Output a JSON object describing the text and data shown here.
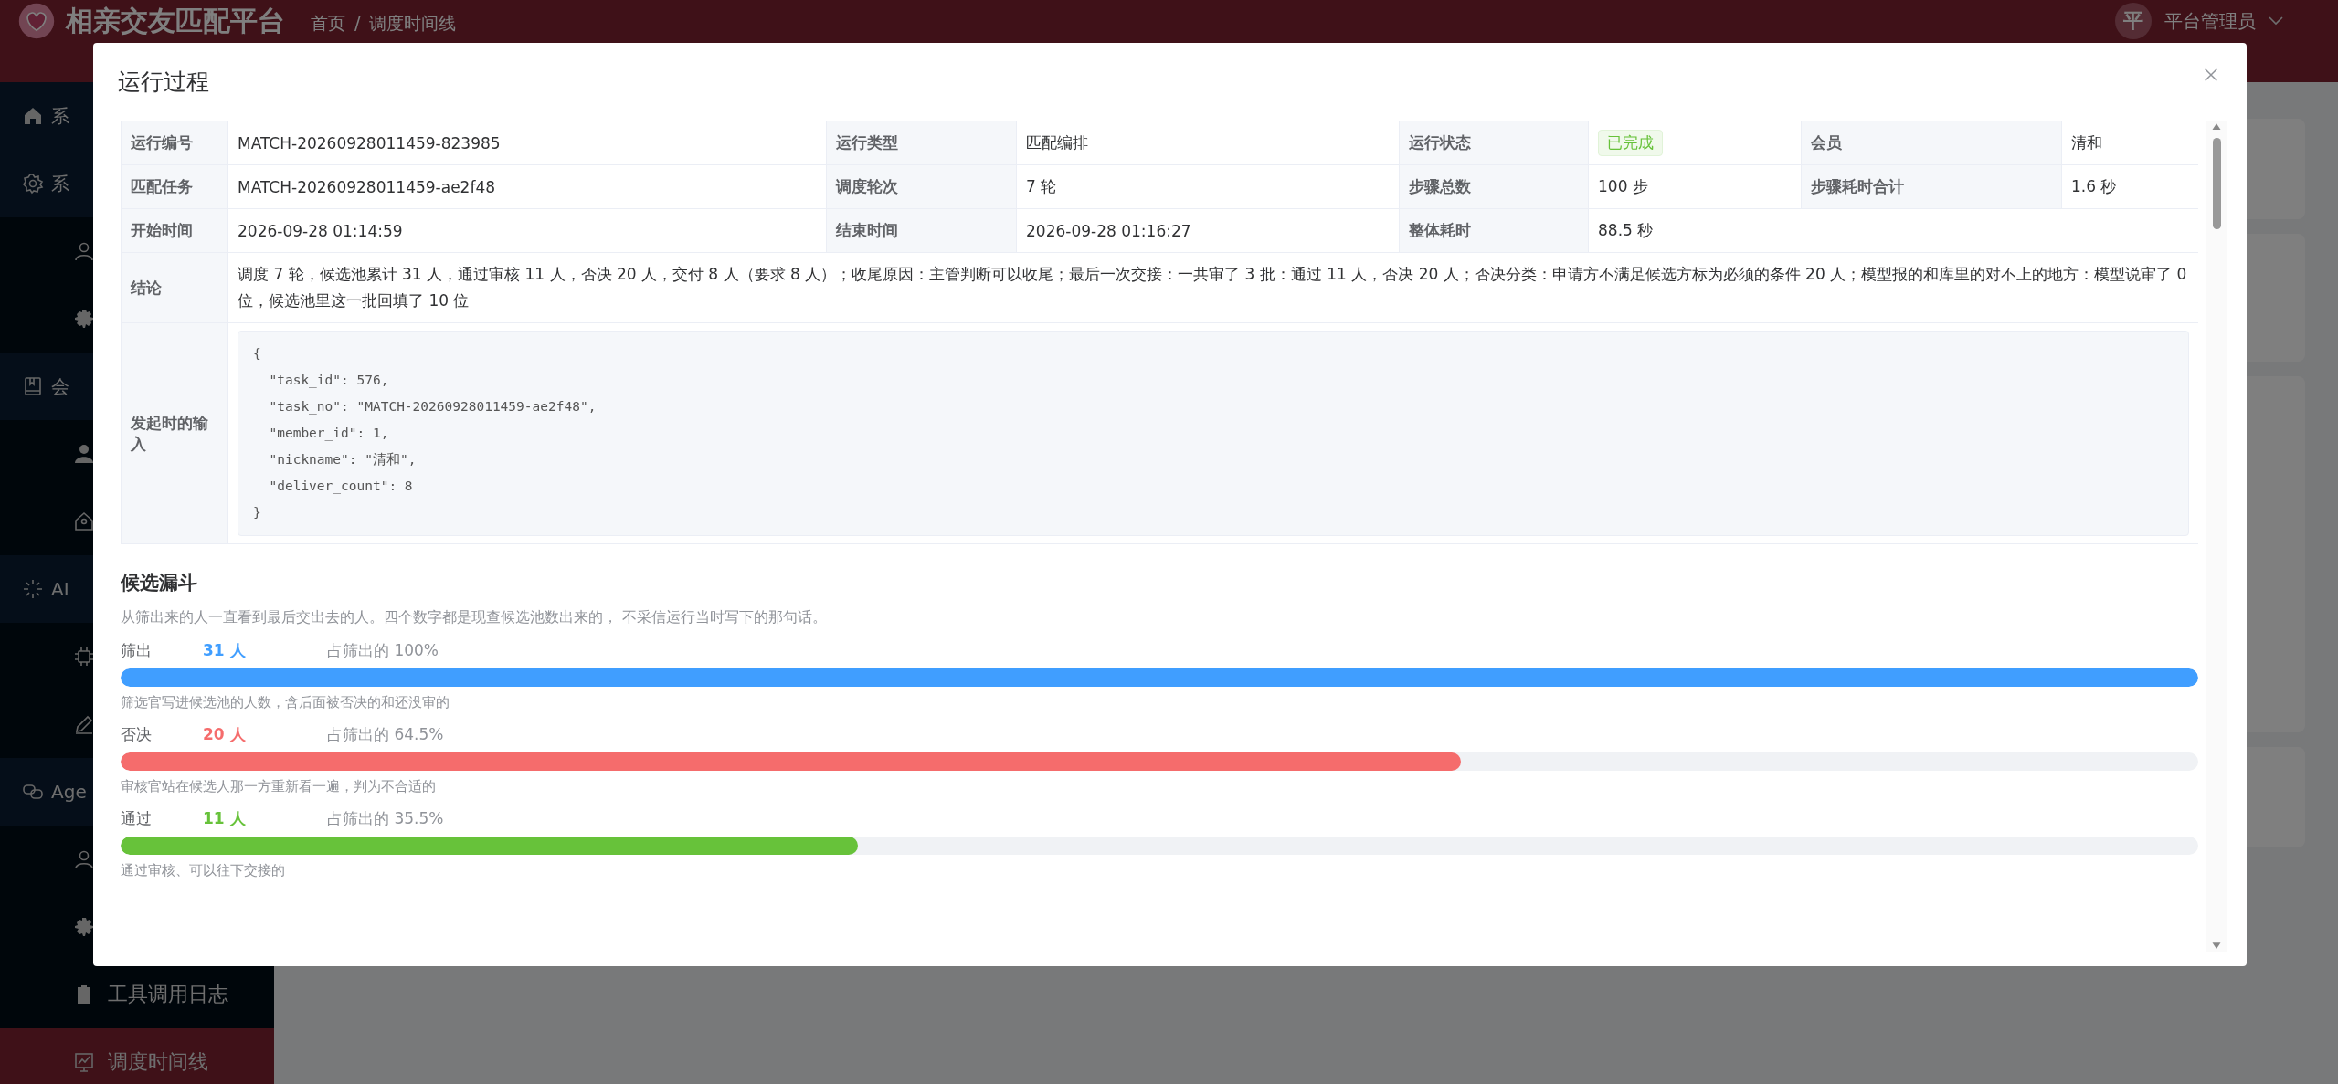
{
  "header": {
    "title": "相亲交友匹配平台",
    "breadcrumb": [
      "首页",
      "调度时间线"
    ],
    "separator": "/",
    "avatar": "平",
    "user": "平台管理员"
  },
  "sidebar": {
    "items": [
      {
        "label": "系",
        "selected": false
      },
      {
        "label": "系",
        "selected": false,
        "children": [
          {
            "selected": false
          },
          {
            "selected": false
          }
        ]
      },
      {
        "label": "会",
        "selected": false,
        "children": [
          {
            "selected": false
          },
          {
            "selected": false
          }
        ]
      },
      {
        "label": "AI",
        "selected": false,
        "children": [
          {
            "selected": false
          },
          {
            "selected": false
          }
        ]
      },
      {
        "label": "Age",
        "selected": false,
        "children": [
          {
            "selected": false
          },
          {
            "selected": false
          },
          {
            "label": "工具调用日志",
            "selected": false
          },
          {
            "label": "调度时间线",
            "selected": true
          }
        ]
      }
    ]
  },
  "dialog": {
    "title": "运行过程",
    "details": [
      [
        {
          "label": "运行编号",
          "value": "MATCH-20260928011459-823985"
        },
        {
          "label": "运行类型",
          "value": "匹配编排"
        },
        {
          "label": "运行状态",
          "value": "已完成",
          "kind": "tag"
        },
        {
          "label": "会员",
          "value": "清和"
        }
      ],
      [
        {
          "label": "匹配任务",
          "value": "MATCH-20260928011459-ae2f48"
        },
        {
          "label": "调度轮次",
          "value": "7 轮"
        },
        {
          "label": "步骤总数",
          "value": "100 步"
        },
        {
          "label": "步骤耗时合计",
          "value": "1.6 秒"
        }
      ],
      [
        {
          "label": "开始时间",
          "value": "2026-09-28 01:14:59"
        },
        {
          "label": "结束时间",
          "value": "2026-09-28 01:16:27"
        },
        {
          "label": "整体耗时",
          "value": "88.5 秒"
        }
      ]
    ],
    "conclusion": {
      "label": "结论",
      "value": "调度 7 轮，候选池累计 31 人，通过审核 11 人，否决 20 人，交付 8 人（要求 8 人）；收尾原因：主管判断可以收尾；最后一次交接：一共审了 3 批：通过 11 人，否决 20 人；否决分类：申请方不满足候选方标为必须的条件 20 人；模型报的和库里的对不上的地方：模型说审了 0 位，候选池里这一批回填了 10 位"
    },
    "input": {
      "label": "发起时的输入",
      "code": "{\n  \"task_id\": 576,\n  \"task_no\": \"MATCH-20260928011459-ae2f48\",\n  \"member_id\": 1,\n  \"nickname\": \"清和\",\n  \"deliver_count\": 8\n}"
    },
    "funnel": {
      "title": "候选漏斗",
      "description": "从筛出来的人一直看到最后交出去的人。四个数字都是现查候选池数出来的， 不采信运行当时写下的那句话。",
      "stages": [
        {
          "label": "筛出",
          "count": "31 人",
          "share": "占筛出的 100%",
          "level": 1,
          "color": "#409eff",
          "note": "筛选官写进候选池的人数，含后面被否决的和还没审的"
        },
        {
          "label": "否决",
          "count": "20 人",
          "share": "占筛出的 64.5%",
          "level": 0.645,
          "color": "#f56c6c",
          "note": "审核官站在候选人那一方重新看一遍，判为不合适的"
        },
        {
          "label": "通过",
          "count": "11 人",
          "share": "占筛出的 35.5%",
          "level": 0.355,
          "color": "#67c23a",
          "note": "通过审核、可以往下交接的"
        }
      ]
    }
  }
}
